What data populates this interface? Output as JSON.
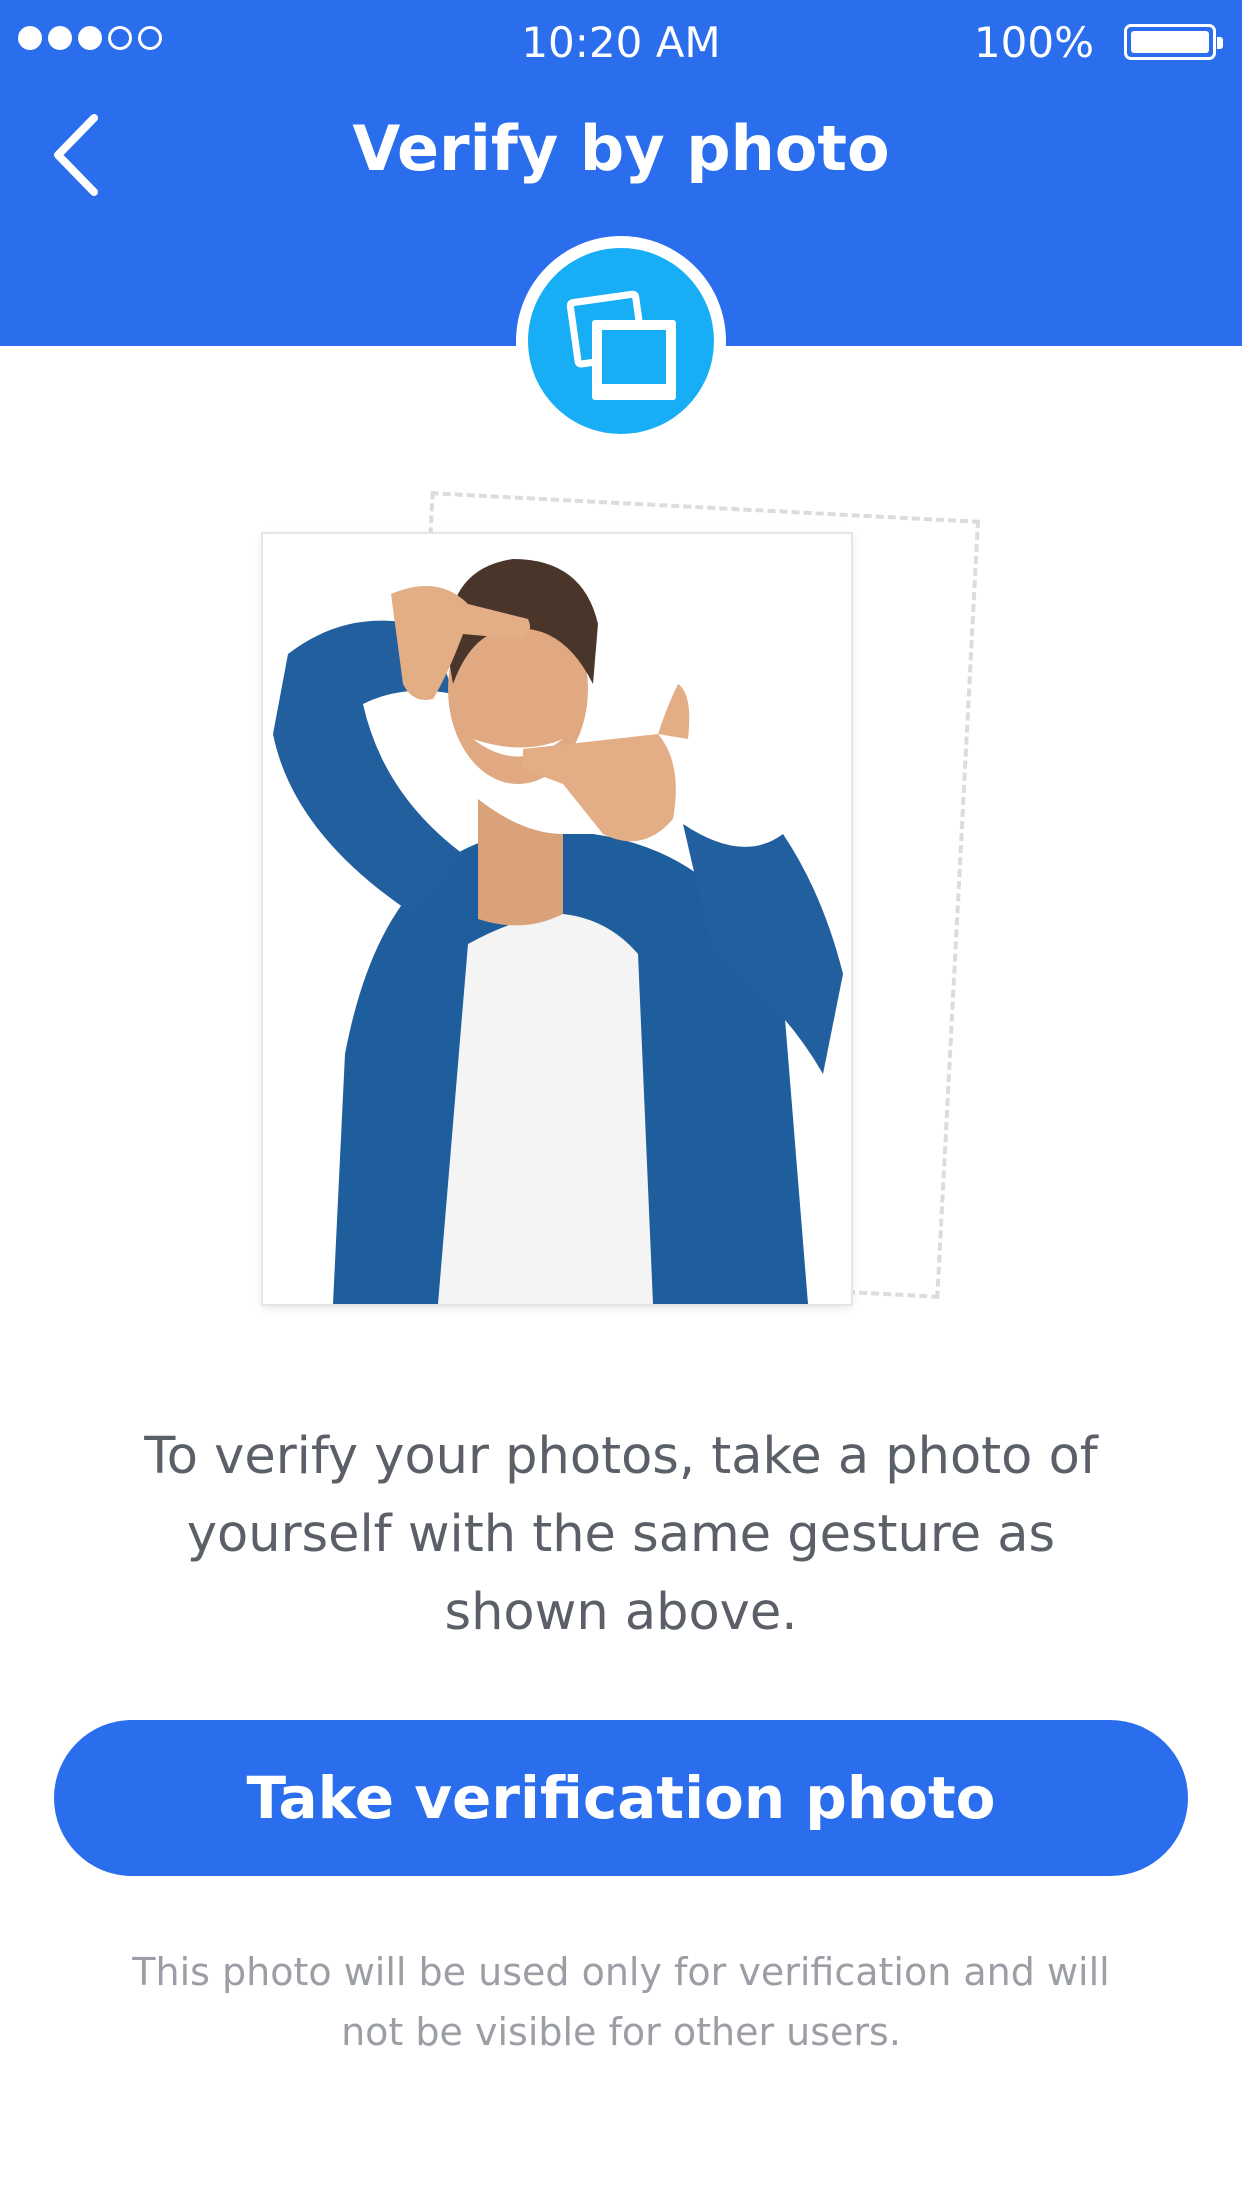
{
  "status_bar": {
    "signal_bars_filled": 3,
    "signal_bars_total": 5,
    "time": "10:20 AM",
    "battery_percent": "100%",
    "battery_level": 1.0
  },
  "header": {
    "title": "Verify by photo",
    "back_icon": "chevron-left-icon",
    "badge_icon": "photos-icon"
  },
  "main": {
    "instruction": "To verify your photos, take a photo of yourself with the same gesture as shown above.",
    "button_label": "Take verification photo",
    "footnote": "This photo will be used only for verification and will not be visible for other users."
  },
  "colors": {
    "primary_blue": "#2a6ded",
    "badge_blue": "#17aef5",
    "text_gray": "#5b6068",
    "muted_gray": "#9b9fa5"
  }
}
